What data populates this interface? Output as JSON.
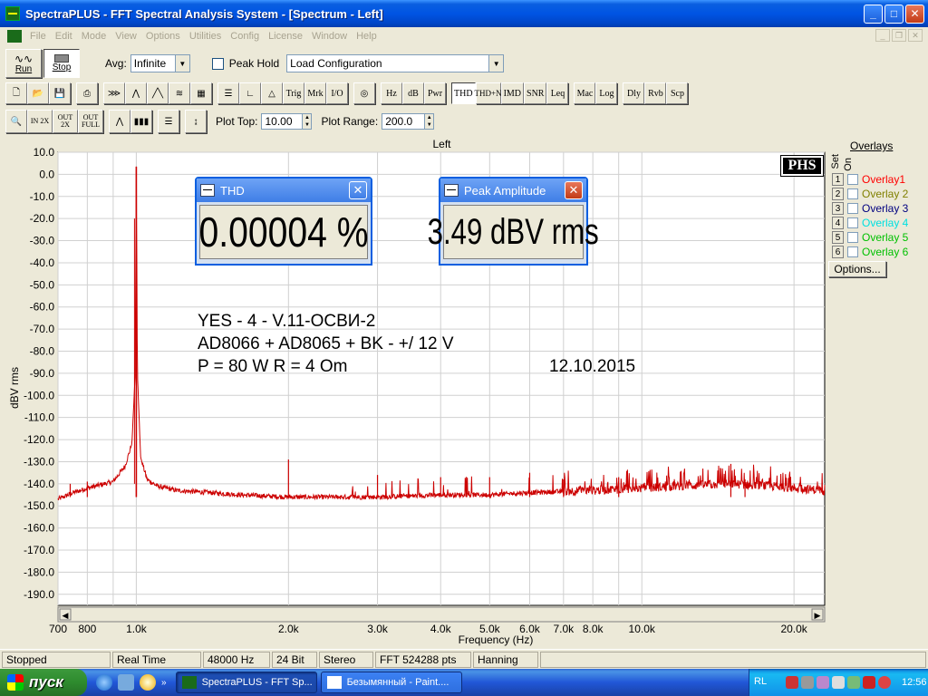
{
  "window": {
    "title": "SpectraPLUS - FFT Spectral Analysis System - [Spectrum - Left]"
  },
  "menu": [
    "File",
    "Edit",
    "Mode",
    "View",
    "Options",
    "Utilities",
    "Config",
    "License",
    "Window",
    "Help"
  ],
  "toolbar1": {
    "run_label": "Run",
    "stop_label": "Stop",
    "avg_label": "Avg:",
    "avg_value": "Infinite",
    "peak_hold_label": "Peak Hold",
    "config_value": "Load Configuration"
  },
  "toolbar2": {
    "text_buttons": [
      "Trig",
      "Mrk",
      "I/O",
      "Hz",
      "dB",
      "Pwr",
      "THD",
      "THD+N",
      "IMD",
      "SNR",
      "Leq",
      "Mac",
      "Log",
      "Dly",
      "Rvb",
      "Scp"
    ]
  },
  "toolbar3": {
    "zoom_in_label": "IN 2X",
    "zoom_out_label": "OUT 2X",
    "zoom_full_label": "OUT FULL",
    "plot_top_label": "Plot Top:",
    "plot_top_value": "10.00",
    "plot_range_label": "Plot Range:",
    "plot_range_value": "200.0"
  },
  "plot": {
    "title": "Left",
    "badge": "PHS",
    "annotation_line1": "YES - 4 - V.11-ОСВИ-2",
    "annotation_line2": "AD8066 + AD8065 + BK - +/ 12 V",
    "annotation_line3": "P = 80 W   R = 4 Om",
    "annotation_date": "12.10.2015"
  },
  "meters": {
    "thd": {
      "title": "THD",
      "value": "0.00004 %"
    },
    "peak": {
      "title": "Peak Amplitude",
      "value": "3.49 dBV rms"
    }
  },
  "overlays": {
    "header": "Overlays",
    "set_label": "Set",
    "on_label": "On",
    "items": [
      {
        "num": "1",
        "label": "Overlay1",
        "color": "#ff0000"
      },
      {
        "num": "2",
        "label": "Overlay 2",
        "color": "#808000"
      },
      {
        "num": "3",
        "label": "Overlay 3",
        "color": "#000080"
      },
      {
        "num": "4",
        "label": "Overlay 4",
        "color": "#00ffff"
      },
      {
        "num": "5",
        "label": "Overlay 5",
        "color": "#00c000"
      },
      {
        "num": "6",
        "label": "Overlay 6",
        "color": "#00c000"
      }
    ],
    "options_label": "Options..."
  },
  "status": [
    "Stopped",
    "Real Time",
    "48000 Hz",
    "24 Bit",
    "Stereo",
    "FFT 524288 pts",
    "Hanning"
  ],
  "taskbar": {
    "start_label": "пуск",
    "tasks": [
      "SpectraPLUS - FFT Sp...",
      "Безымянный - Paint...."
    ],
    "lang": "RL",
    "clock": "12:56"
  },
  "chart_data": {
    "type": "line",
    "title": "Left",
    "xlabel": "Frequency (Hz)",
    "ylabel": "dBV rms",
    "xscale": "log",
    "xlim": [
      700,
      23000
    ],
    "ylim": [
      -195,
      10
    ],
    "x_ticks": [
      "700",
      "800",
      "1.0k",
      "2.0k",
      "3.0k",
      "4.0k",
      "5.0k",
      "6.0k",
      "7.0k",
      "8.0k",
      "10.0k",
      "20.0k"
    ],
    "x_tick_values": [
      700,
      800,
      1000,
      2000,
      3000,
      4000,
      5000,
      6000,
      7000,
      8000,
      10000,
      20000
    ],
    "y_ticks": [
      "10.0",
      "0.0",
      "-10.0",
      "-20.0",
      "-30.0",
      "-40.0",
      "-50.0",
      "-60.0",
      "-70.0",
      "-80.0",
      "-90.0",
      "-100.0",
      "-110.0",
      "-120.0",
      "-130.0",
      "-140.0",
      "-150.0",
      "-160.0",
      "-170.0",
      "-180.0",
      "-190.0"
    ],
    "y_tick_values": [
      10,
      0,
      -10,
      -20,
      -30,
      -40,
      -50,
      -60,
      -70,
      -80,
      -90,
      -100,
      -110,
      -120,
      -130,
      -140,
      -150,
      -160,
      -170,
      -180,
      -190
    ],
    "series": [
      {
        "color": "#cc0000",
        "fundamental": {
          "x": 1000,
          "y": 3.5
        },
        "noise_floor": -146,
        "x": [
          700,
          750,
          800,
          900,
          950,
          980,
          995,
          1000,
          1005,
          1020,
          1050,
          1100,
          1200,
          1400,
          1600,
          2000,
          2500,
          3000,
          4000,
          5000,
          6000,
          8000,
          10000,
          12000,
          15000,
          18000,
          20000,
          23000
        ],
        "y": [
          -147,
          -144,
          -142,
          -139,
          -132,
          -122,
          -90,
          3.5,
          -90,
          -128,
          -138,
          -141,
          -143,
          -144,
          -145,
          -146,
          -146,
          -146,
          -145,
          -145,
          -144,
          -143,
          -142,
          -141,
          -140,
          -141,
          -142,
          -143
        ],
        "spurs": [
          {
            "x": 740,
            "y": -140
          },
          {
            "x": 800,
            "y": -139
          },
          {
            "x": 2000,
            "y": -129
          },
          {
            "x": 3000,
            "y": -136
          },
          {
            "x": 4000,
            "y": -137
          },
          {
            "x": 5000,
            "y": -137
          },
          {
            "x": 6000,
            "y": -135
          },
          {
            "x": 7000,
            "y": -138
          },
          {
            "x": 9000,
            "y": -137
          },
          {
            "x": 15000,
            "y": -131
          },
          {
            "x": 16000,
            "y": -138
          }
        ]
      }
    ]
  }
}
